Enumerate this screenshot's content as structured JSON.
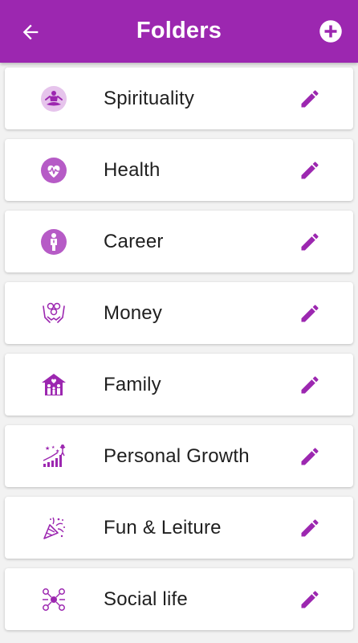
{
  "appbar": {
    "title": "Folders",
    "back_icon": "arrow-left-icon",
    "add_icon": "plus-circle-icon"
  },
  "colors": {
    "primary": "#9c27b0",
    "icon": "#9c27b0",
    "text": "#1f1f1f",
    "background": "#f2f2f2"
  },
  "folders": [
    {
      "label": "Spirituality",
      "icon": "meditation-icon"
    },
    {
      "label": "Health",
      "icon": "heart-pulse-icon"
    },
    {
      "label": "Career",
      "icon": "businessperson-icon"
    },
    {
      "label": "Money",
      "icon": "hands-coins-icon"
    },
    {
      "label": "Family",
      "icon": "family-house-icon"
    },
    {
      "label": "Personal Growth",
      "icon": "growth-chart-icon"
    },
    {
      "label": "Fun & Leiture",
      "icon": "party-popper-icon"
    },
    {
      "label": "Social life",
      "icon": "social-network-icon"
    }
  ]
}
